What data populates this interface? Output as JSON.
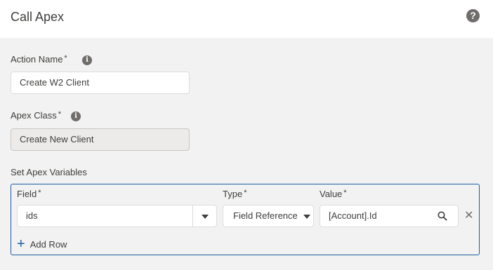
{
  "header": {
    "title": "Call Apex",
    "help_icon": "question-circle-icon"
  },
  "form": {
    "action_name": {
      "label": "Action Name",
      "required": "*",
      "value": "Create W2 Client"
    },
    "apex_class": {
      "label": "Apex Class",
      "required": "*",
      "value": "Create New Client"
    },
    "section_label": "Set Apex Variables"
  },
  "variables": {
    "field_header": "Field",
    "type_header": "Type",
    "value_header": "Value",
    "required": "*",
    "rows": [
      {
        "field": "ids",
        "type": "Field Reference",
        "value": "[Account].Id"
      }
    ],
    "add_row": "Add Row"
  },
  "colors": {
    "accent": "#1b5f9e",
    "background": "#f3f2f2",
    "text": "#3e3e3c"
  }
}
